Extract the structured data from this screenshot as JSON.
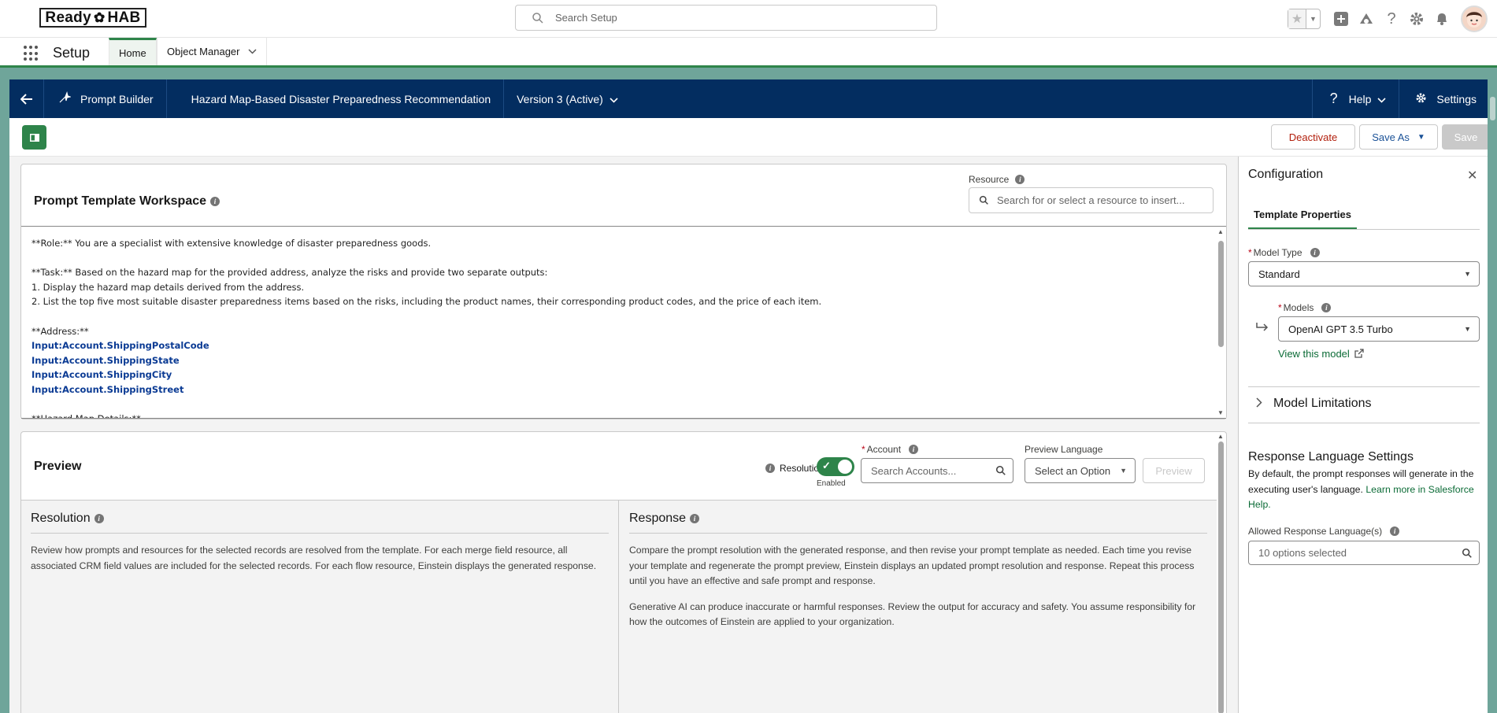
{
  "header": {
    "logo_text_left": "Ready",
    "logo_text_right": "HAB",
    "search_placeholder": "Search Setup"
  },
  "context": {
    "app_name": "Setup",
    "tabs": [
      {
        "label": "Home"
      },
      {
        "label": "Object Manager"
      }
    ]
  },
  "builder": {
    "app_label": "Prompt Builder",
    "template_name": "Hazard Map-Based Disaster Preparedness Recommendation",
    "version": "Version 3 (Active)",
    "help_label": "Help",
    "settings_label": "Settings"
  },
  "toolbar": {
    "deactivate_label": "Deactivate",
    "save_as_label": "Save As",
    "save_label": "Save"
  },
  "workspace": {
    "title": "Prompt Template Workspace",
    "resource_label": "Resource",
    "resource_placeholder": "Search for or select a resource to insert...",
    "lines": {
      "l1": "**Role:** You are a specialist with extensive knowledge of disaster preparedness goods.",
      "l2": "**Task:** Based on the hazard map for the provided address, analyze the risks and provide two separate outputs:",
      "l3": "1. Display the hazard map details derived from the address.",
      "l4": "2. List the top five most suitable disaster preparedness items based on the risks, including the product names, their corresponding product codes, and the price of each item.",
      "l5": "**Address:**",
      "m1": "Input:Account.ShippingPostalCode",
      "m2": "Input:Account.ShippingState",
      "m3": "Input:Account.ShippingCity",
      "m4": "Input:Account.ShippingStreet",
      "l6": "**Hazard Map Details:**"
    }
  },
  "preview": {
    "title": "Preview",
    "resolution_label": "Resolution",
    "toggle_caption": "Enabled",
    "account_label": "Account",
    "account_placeholder": "Search Accounts...",
    "language_label": "Preview Language",
    "language_placeholder": "Select an Option",
    "preview_button": "Preview",
    "resolution_heading": "Resolution",
    "resolution_text": "Review how prompts and resources for the selected records are resolved from the template. For each merge field resource, all associated CRM field values are included for the selected records. For each flow resource, Einstein displays the generated response.",
    "response_heading": "Response",
    "response_text_1": "Compare the prompt resolution with the generated response, and then revise your prompt template as needed. Each time you revise your template and regenerate the prompt preview, Einstein displays an updated prompt resolution and response. Repeat this process until you have an effective and safe prompt and response.",
    "response_text_2": "Generative AI can produce inaccurate or harmful responses. Review the output for accuracy and safety. You assume responsibility for how the outcomes of Einstein are applied to your organization."
  },
  "config": {
    "title": "Configuration",
    "tab_label": "Template Properties",
    "model_type_label": "Model Type",
    "model_type_value": "Standard",
    "models_label": "Models",
    "models_value": "OpenAI GPT 3.5 Turbo",
    "view_model_link": "View this model",
    "limitations_label": "Model Limitations",
    "response_lang_title": "Response Language Settings",
    "response_lang_desc": "By default, the prompt responses will generate in the executing user's language.",
    "response_lang_link": "Learn more in Salesforce Help.",
    "allowed_label": "Allowed Response Language(s)",
    "allowed_placeholder": "10 options selected"
  },
  "colors": {
    "brand_green": "#2e844a",
    "builder_bar": "#032d60",
    "destructive": "#b21f0c",
    "merge_field": "#0b3b94"
  }
}
